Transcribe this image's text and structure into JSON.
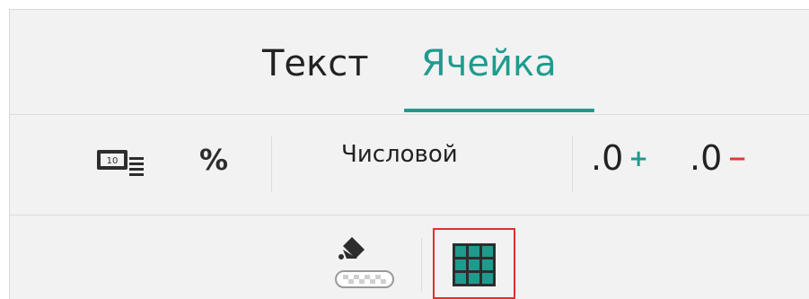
{
  "tabs": [
    {
      "label": "Текст",
      "active": false
    },
    {
      "label": "Ячейка",
      "active": true
    }
  ],
  "toolbar": {
    "currency_icon": "currency-format-icon",
    "percent_label": "%",
    "number_format_value": "Числовой",
    "increase_decimal": {
      "digits": ".0",
      "sign": "+"
    },
    "decrease_decimal": {
      "digits": ".0",
      "sign": "−"
    }
  },
  "row2": {
    "fill_icon": "fill-color-icon",
    "borders_icon": "cell-borders-icon"
  },
  "colors": {
    "accent": "#1f9b8e",
    "plus": "#1f9b8e",
    "minus": "#e03a3a",
    "highlight": "#e03030"
  }
}
